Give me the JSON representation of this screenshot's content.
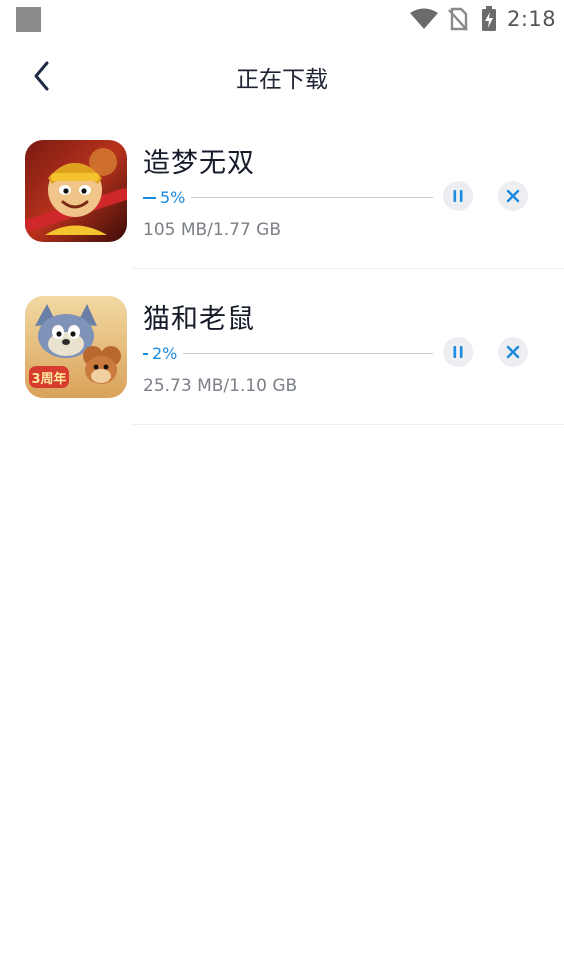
{
  "status_bar": {
    "time": "2:18"
  },
  "header": {
    "title": "正在下载"
  },
  "downloads": [
    {
      "name": "造梦无双",
      "progress_percent": 5,
      "progress_label": "5%",
      "size_text": "105 MB/1.77 GB"
    },
    {
      "name": "猫和老鼠",
      "progress_percent": 2,
      "progress_label": "2%",
      "size_text": "25.73 MB/1.10 GB"
    }
  ],
  "colors": {
    "accent": "#1b8be0",
    "track": "#c8ccd2",
    "button_bg": "#eceef1",
    "title_text": "#1f2433",
    "meta_text": "#7b7f87"
  },
  "icons": {
    "back": "chevron-left-icon",
    "pause": "pause-icon",
    "cancel": "close-icon"
  }
}
